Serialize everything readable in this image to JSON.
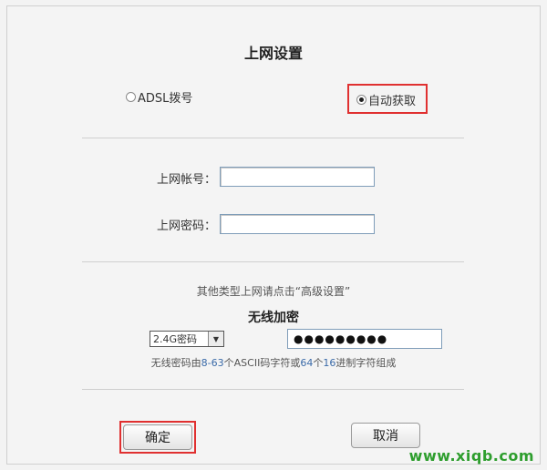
{
  "page": {
    "title": "上网设置"
  },
  "connection": {
    "options": [
      {
        "label": "ADSL拨号",
        "checked": false
      },
      {
        "label": "自动获取",
        "checked": true
      }
    ]
  },
  "account": {
    "username_label": "上网帐号：",
    "username_value": "",
    "password_label": "上网密码：",
    "password_value": ""
  },
  "hint": "其他类型上网请点击“高级设置”",
  "wireless": {
    "title": "无线加密",
    "band_selected": "2.4G密码",
    "password_mask": "●●●●●●●●●",
    "rule_parts": [
      "无线密码由",
      "8-63",
      "个ASCII码字符或",
      "64",
      "个",
      "16",
      "进制字符组成"
    ]
  },
  "buttons": {
    "confirm": "确定",
    "cancel": "取消"
  },
  "watermark": "www.xiqb.com",
  "colors": {
    "highlight": "#e03030",
    "watermark": "#2e9e2e",
    "accent_number": "#3a6aa8"
  }
}
